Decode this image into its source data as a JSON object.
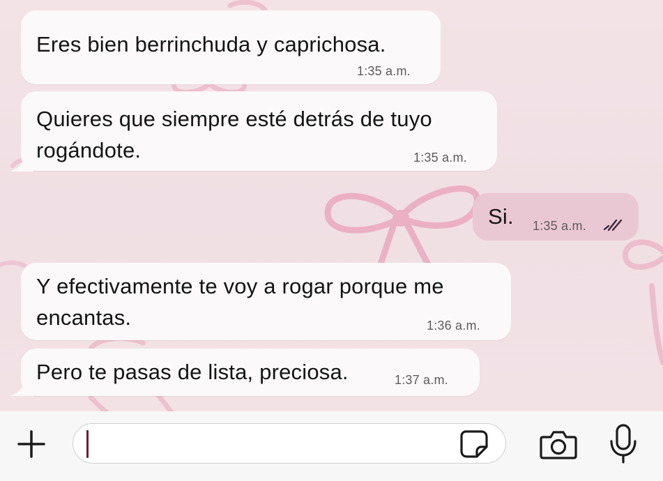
{
  "messages": [
    {
      "direction": "incoming",
      "lines": [
        "Eres bien berrinchuda y caprichosa."
      ],
      "time": "1:35 a.m."
    },
    {
      "direction": "incoming",
      "lines": [
        "Quieres que siempre esté detrás de tuyo",
        "rogándote."
      ],
      "time": "1:35 a.m."
    },
    {
      "direction": "outgoing",
      "lines": [
        "Si."
      ],
      "time": "1:35 a.m.",
      "status": "read"
    },
    {
      "direction": "incoming",
      "lines": [
        "Y efectivamente te voy a rogar porque me",
        "encantas."
      ],
      "time": "1:36 a.m."
    },
    {
      "direction": "incoming",
      "lines": [
        "Pero te pasas de lista, preciosa."
      ],
      "time": "1:37 a.m."
    }
  ],
  "composer": {
    "input_value": "",
    "icons": {
      "attach": "plus-icon",
      "sticker": "sticker-icon",
      "camera": "camera-icon",
      "voice": "microphone-icon"
    }
  },
  "colors": {
    "background": "#f1e2e6",
    "incoming_bubble": "#fbf9f9",
    "outgoing_bubble": "#eac8d3",
    "bow": "#eaa8bf",
    "read_ticks": "#3b2a3a",
    "caret": "#6a1e34"
  },
  "wallpaper": "pink-ribbon-bows"
}
